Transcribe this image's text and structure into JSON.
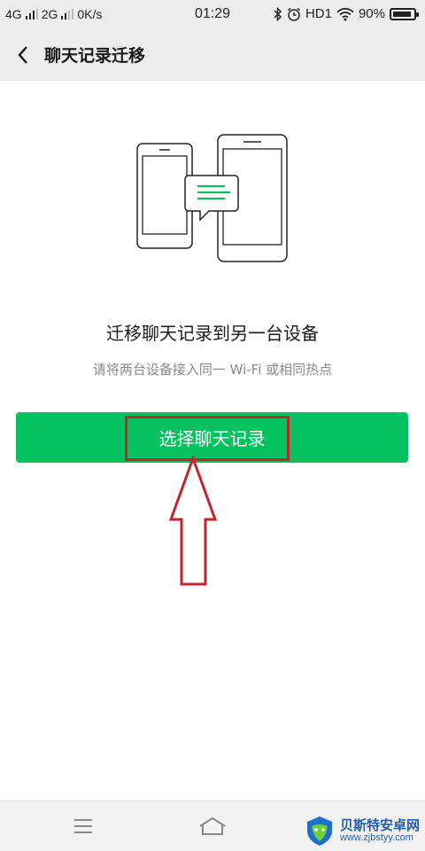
{
  "status_bar": {
    "network_1": "4G",
    "network_2": "2G",
    "speed": "0K/s",
    "time": "01:29",
    "hd_label": "HD1",
    "battery_text": "90%",
    "battery_level": 0.9
  },
  "header": {
    "title": "聊天记录迁移"
  },
  "main": {
    "headline": "迁移聊天记录到另一台设备",
    "subline": "请将两台设备接入同一 Wi-Fi 或相同热点",
    "primary_button_label": "选择聊天记录"
  },
  "watermark": {
    "title": "贝斯特安卓网",
    "url": "www.zjbstyy.com"
  },
  "colors": {
    "accent": "#07c160",
    "annotation": "#c0262d",
    "background_bar": "#ededed"
  }
}
